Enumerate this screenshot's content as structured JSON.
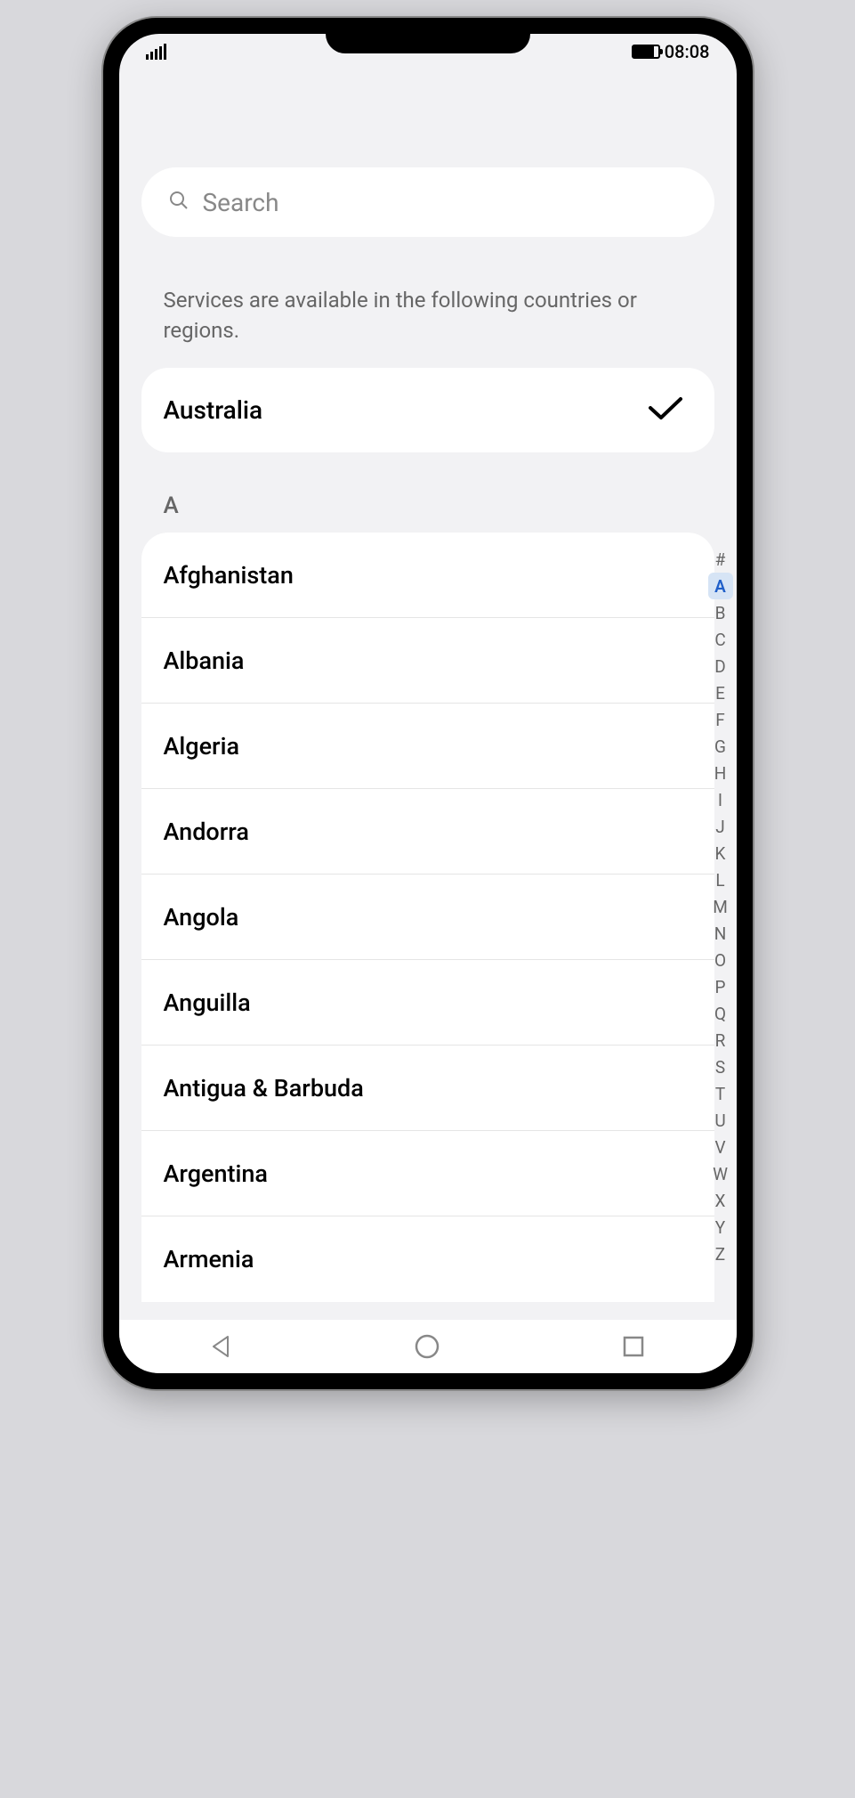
{
  "status": {
    "time": "08:08"
  },
  "search": {
    "placeholder": "Search"
  },
  "info_text": "Services are available in the following countries or regions.",
  "selected": {
    "label": "Australia"
  },
  "section_header": "A",
  "list": {
    "items": [
      {
        "label": "Afghanistan"
      },
      {
        "label": "Albania"
      },
      {
        "label": "Algeria"
      },
      {
        "label": "Andorra"
      },
      {
        "label": "Angola"
      },
      {
        "label": "Anguilla"
      },
      {
        "label": "Antigua & Barbuda"
      },
      {
        "label": "Argentina"
      },
      {
        "label": "Armenia"
      }
    ]
  },
  "alpha_index": {
    "letters": [
      "#",
      "A",
      "B",
      "C",
      "D",
      "E",
      "F",
      "G",
      "H",
      "I",
      "J",
      "K",
      "L",
      "M",
      "N",
      "O",
      "P",
      "Q",
      "R",
      "S",
      "T",
      "U",
      "V",
      "W",
      "X",
      "Y",
      "Z"
    ],
    "active": "A"
  }
}
